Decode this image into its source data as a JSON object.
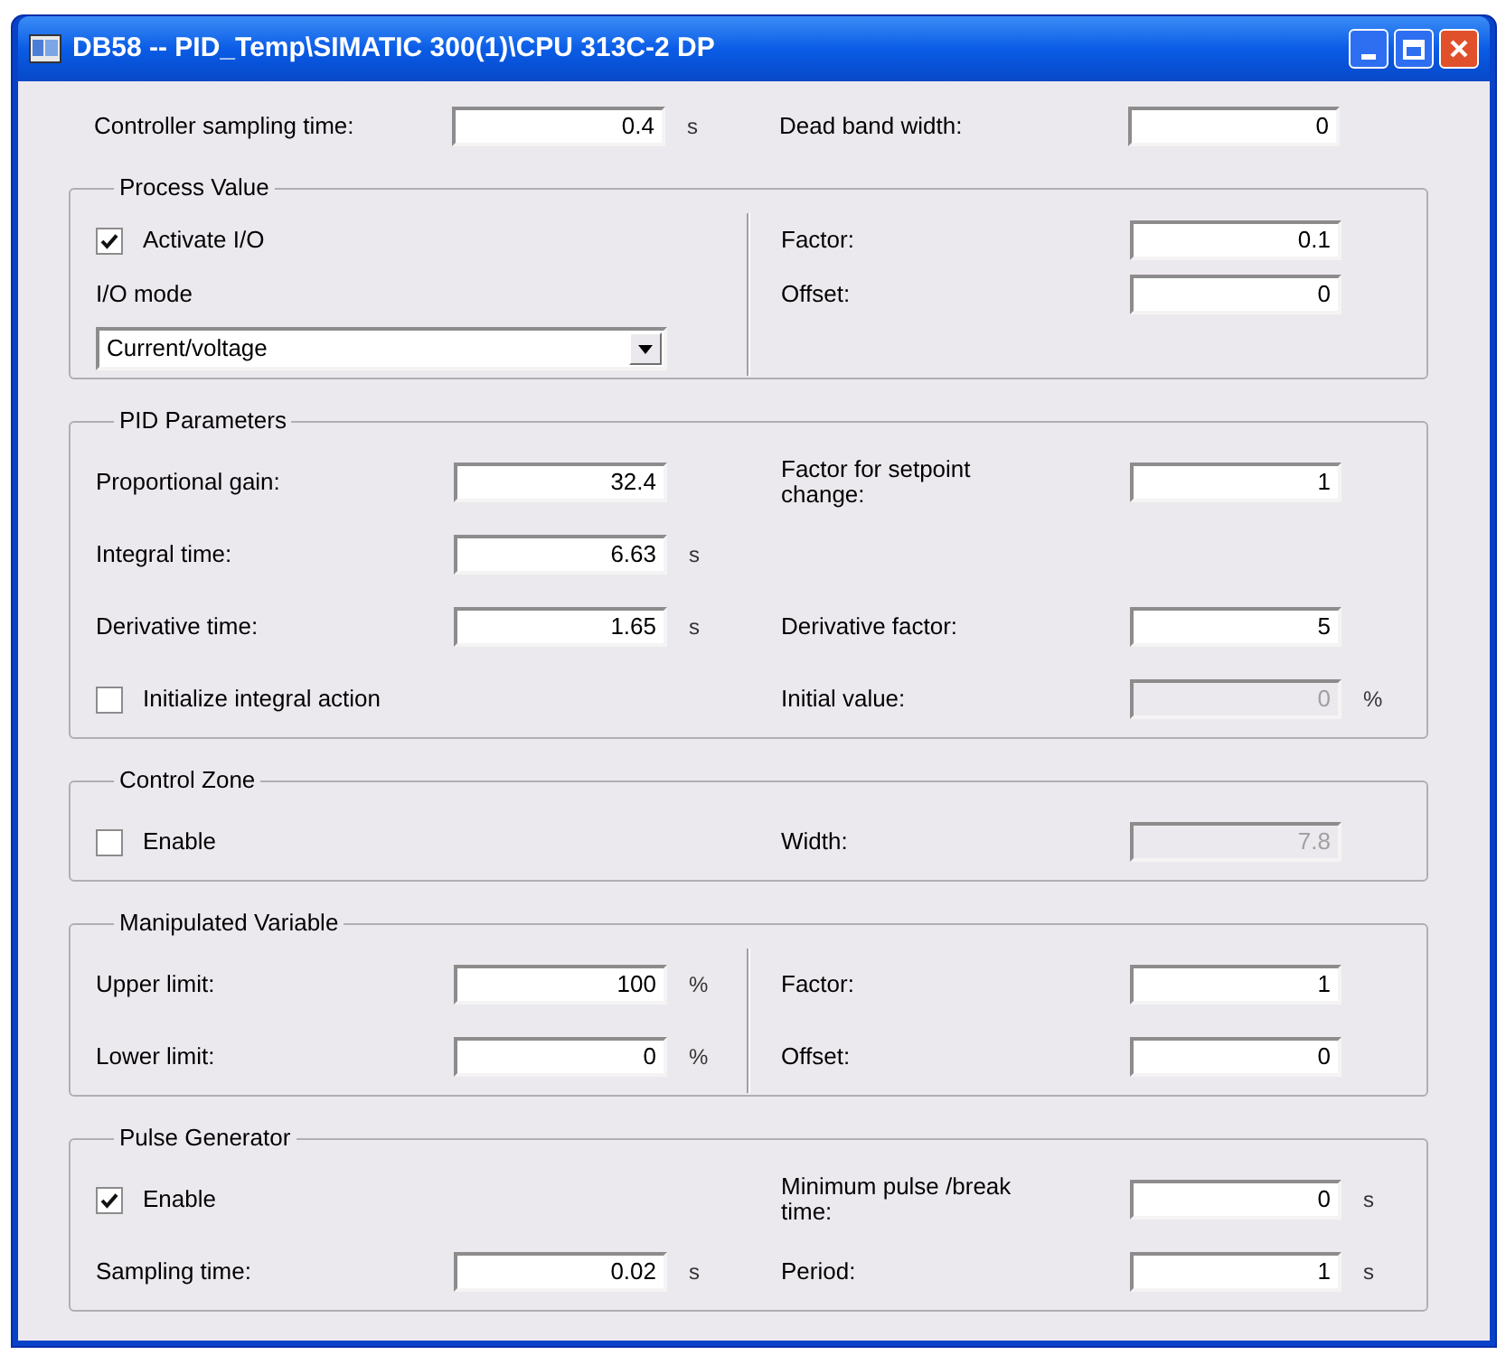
{
  "window": {
    "title": "DB58 -- PID_Temp\\SIMATIC 300(1)\\CPU 313C-2 DP"
  },
  "top_row": {
    "left": {
      "kind": "field",
      "label": "Controller sampling time:",
      "value": "0.4",
      "unit": "s",
      "disabled": false
    },
    "right": {
      "kind": "field",
      "label": "Dead band width:",
      "value": "0",
      "disabled": false
    }
  },
  "groups": [
    {
      "title": "Process Value",
      "divider": true,
      "rows": [
        {
          "left": {
            "kind": "checkbox",
            "label": "Activate I/O",
            "checked": true
          },
          "right": {
            "kind": "field",
            "label": "Factor:",
            "value": "0.1",
            "disabled": false
          }
        },
        {
          "left": {
            "kind": "label",
            "label": "I/O mode"
          },
          "right": {
            "kind": "field",
            "label": "Offset:",
            "value": "0",
            "disabled": false
          }
        },
        {
          "left": {
            "kind": "dropdown",
            "value": "Current/voltage"
          }
        }
      ]
    },
    {
      "title": "PID Parameters",
      "divider": false,
      "rows": [
        {
          "left": {
            "kind": "field",
            "label": "Proportional gain:",
            "value": "32.4",
            "disabled": false
          },
          "right": {
            "kind": "field",
            "label": "Factor for setpoint change:",
            "value": "1",
            "disabled": false
          }
        },
        {
          "left": {
            "kind": "field",
            "label": "Integral time:",
            "value": "6.63",
            "unit": "s",
            "disabled": false
          }
        },
        {
          "left": {
            "kind": "field",
            "label": "Derivative time:",
            "value": "1.65",
            "unit": "s",
            "disabled": false
          },
          "right": {
            "kind": "field",
            "label": "Derivative factor:",
            "value": "5",
            "disabled": false
          }
        },
        {
          "left": {
            "kind": "checkbox",
            "label": "Initialize integral action",
            "checked": false
          },
          "right": {
            "kind": "field",
            "label": "Initial value:",
            "value": "0",
            "unit": "%",
            "disabled": true
          }
        }
      ]
    },
    {
      "title": "Control Zone",
      "divider": false,
      "rows": [
        {
          "left": {
            "kind": "checkbox",
            "label": "Enable",
            "checked": false
          },
          "right": {
            "kind": "field",
            "label": "Width:",
            "value": "7.8",
            "disabled": true
          }
        }
      ]
    },
    {
      "title": "Manipulated Variable",
      "divider": true,
      "rows": [
        {
          "left": {
            "kind": "field",
            "label": "Upper limit:",
            "value": "100",
            "unit": "%",
            "disabled": false
          },
          "right": {
            "kind": "field",
            "label": "Factor:",
            "value": "1",
            "disabled": false
          }
        },
        {
          "left": {
            "kind": "field",
            "label": "Lower limit:",
            "value": "0",
            "unit": "%",
            "disabled": false
          },
          "right": {
            "kind": "field",
            "label": "Offset:",
            "value": "0",
            "disabled": false
          }
        }
      ]
    },
    {
      "title": "Pulse Generator",
      "divider": false,
      "rows": [
        {
          "left": {
            "kind": "checkbox",
            "label": "Enable",
            "checked": true
          },
          "right": {
            "kind": "field",
            "label": "Minimum pulse /break time:",
            "value": "0",
            "unit": "s",
            "disabled": false
          }
        },
        {
          "left": {
            "kind": "field",
            "label": "Sampling time:",
            "value": "0.02",
            "unit": "s",
            "disabled": false
          },
          "right": {
            "kind": "field",
            "label": "Period:",
            "value": "1",
            "unit": "s",
            "disabled": false
          }
        }
      ]
    }
  ]
}
